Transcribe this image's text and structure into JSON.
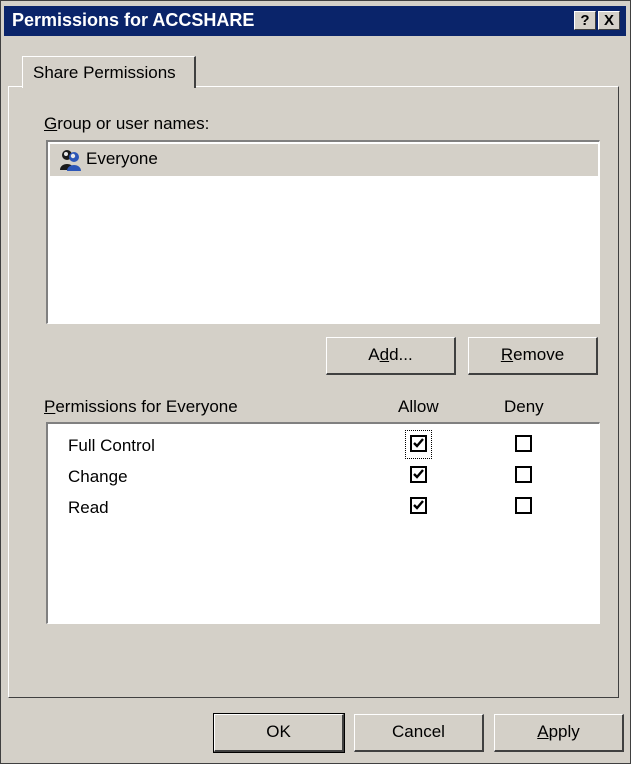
{
  "window": {
    "title": "Permissions for ACCSHARE",
    "help_button": "?",
    "close_button": "X"
  },
  "tabs": [
    {
      "label": "Share Permissions"
    }
  ],
  "groups": {
    "label_prefix": "G",
    "label_rest": "roup or user names:",
    "items": [
      {
        "name": "Everyone",
        "icon": "users-group-icon"
      }
    ]
  },
  "actions": {
    "add_u": "d",
    "add_pre": "A",
    "add_post": "d...",
    "remove_u": "R",
    "remove_rest": "emove"
  },
  "permissions": {
    "label_u": "P",
    "label_rest": "ermissions for Everyone",
    "allow_header": "Allow",
    "deny_header": "Deny",
    "rows": [
      {
        "name": "Full Control",
        "allow": true,
        "deny": false
      },
      {
        "name": "Change",
        "allow": true,
        "deny": false
      },
      {
        "name": "Read",
        "allow": true,
        "deny": false
      }
    ]
  },
  "footer": {
    "ok_label": "OK",
    "cancel_label": "Cancel",
    "apply_u": "A",
    "apply_rest": "pply"
  },
  "colors": {
    "titlebar": "#0a246a",
    "dialog_bg": "#d4d0c8"
  }
}
